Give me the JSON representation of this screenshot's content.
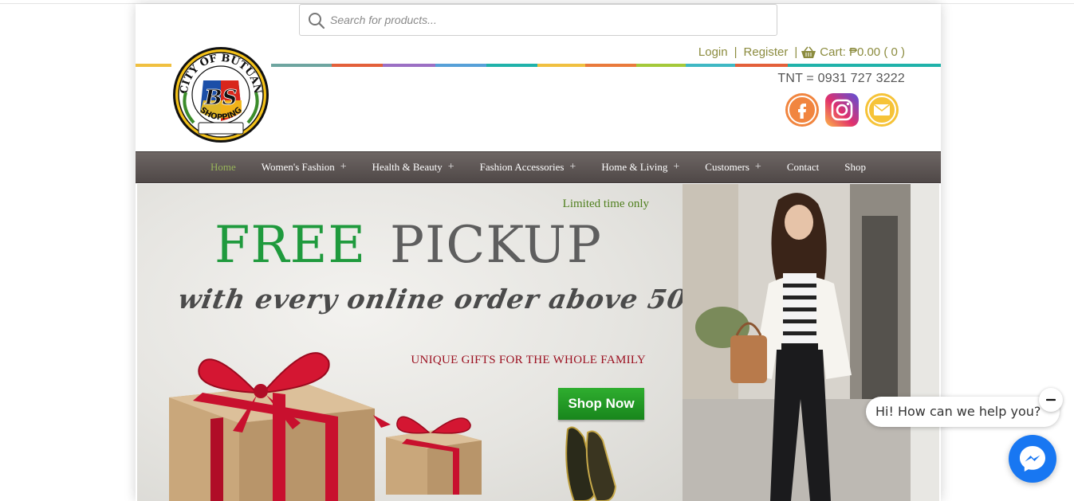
{
  "search": {
    "placeholder": "Search for products..."
  },
  "logo": {
    "name": "City of Butuan BS Shopping logo",
    "ring_top": "CITY OF BUTUAN",
    "monogram": "BS",
    "ring_bottom": "SHOPPING"
  },
  "account": {
    "login": "Login",
    "register": "Register",
    "cart_label": "Cart: ₱0.00 ( 0 )"
  },
  "contact": {
    "phone": "TNT = 0931 727 3222"
  },
  "social": [
    {
      "icon": "facebook-icon",
      "color": "#f1853f"
    },
    {
      "icon": "instagram-icon",
      "color": "#c13584"
    },
    {
      "icon": "email-icon",
      "color": "#f6c338"
    }
  ],
  "nav": {
    "items": [
      {
        "label": "Home",
        "active": true,
        "has_submenu": false
      },
      {
        "label": "Women's Fashion",
        "has_submenu": true
      },
      {
        "label": "Health & Beauty",
        "has_submenu": true
      },
      {
        "label": "Fashion Accessories",
        "has_submenu": true
      },
      {
        "label": "Home & Living",
        "has_submenu": true
      },
      {
        "label": "Customers",
        "has_submenu": true
      },
      {
        "label": "Contact",
        "has_submenu": false
      },
      {
        "label": "Shop",
        "has_submenu": false
      }
    ],
    "plus": "+"
  },
  "hero": {
    "limited": "Limited time only",
    "headline_green": "FREE",
    "headline_dark": "PICKUP",
    "tagline": "with every online order above 50",
    "subtext": "UNIQUE GIFTS FOR THE WHOLE FAMILY",
    "cta": "Shop Now"
  },
  "chat": {
    "message": "Hi! How can we help you?"
  },
  "colors": {
    "accent_olive": "#8b8b3e",
    "nav_bg": "#5a5250",
    "nav_active": "#98b55a",
    "green_cta": "#1f9a3d",
    "messenger_blue": "#1877f2",
    "stripe": [
      "#f0c040",
      "#6ea5a0",
      "#e3603a",
      "#9b6fc4",
      "#56a0d8",
      "#20b2aa",
      "#f0c040",
      "#e97a3c",
      "#a4c93a",
      "#3fb8c4",
      "#e3603a",
      "#20b2aa"
    ]
  }
}
